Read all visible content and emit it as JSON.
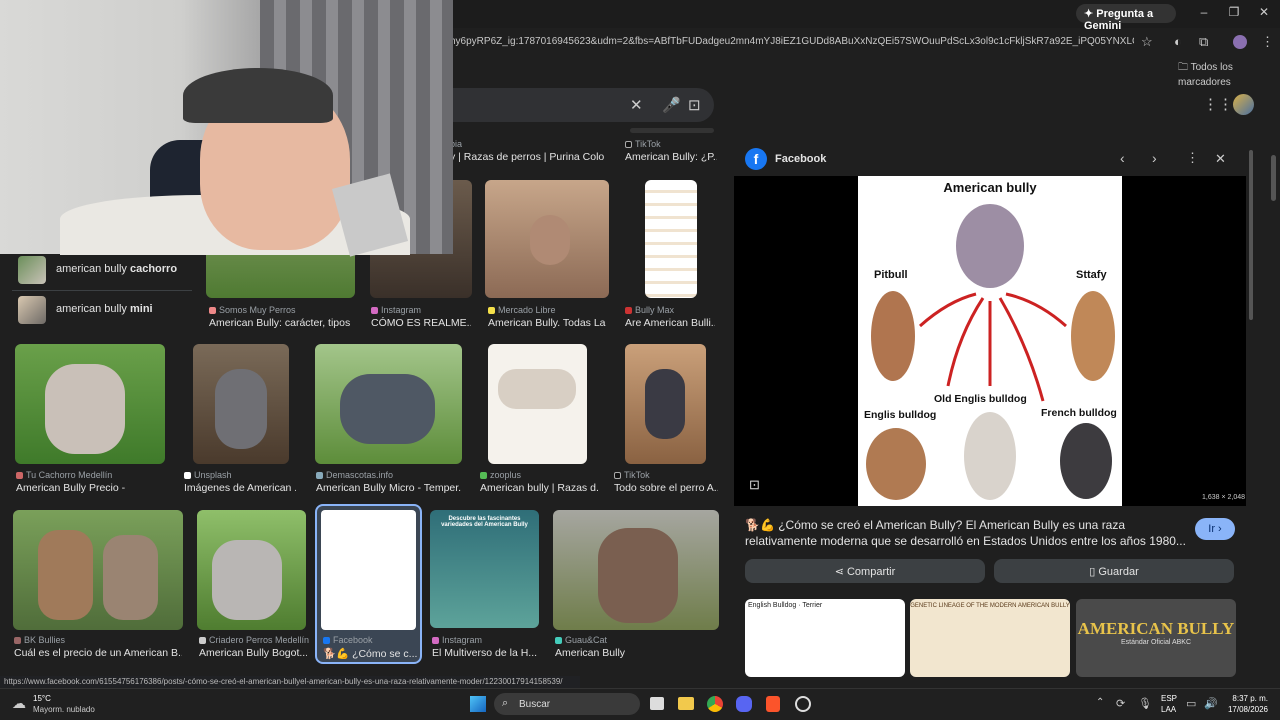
{
  "browser": {
    "gemini_label": "Pregunta a Gemini",
    "url": "hy6pyRP6Z_ig:1787016945623&udm=2&fbs=ABfTbFUDadgeu2mn4mYJ8iEZ1GUDd8ABuXxNzQEi57SWOuuPdScLx3ol9c1cFkljSkR7a92E_iPQ05YNXLGv14hv1DireQD...",
    "bookmarks_label": "Todos los marcadores"
  },
  "results_row0": [
    {
      "source": "bia",
      "caption": "y | Razas de perros | Purina Colo..."
    },
    {
      "source": "TikTok",
      "caption": "American Bully: ¿P..."
    }
  ],
  "suggestions": [
    {
      "prefix": "american bully ",
      "bold": "cachorro"
    },
    {
      "prefix": "american bully ",
      "bold": "mini"
    }
  ],
  "results_row1": [
    {
      "source": "Somos Muy Perros",
      "caption": "American Bully: carácter, tipos ..."
    },
    {
      "source": "Instagram",
      "caption": "CÓMO ES REALME..."
    },
    {
      "source": "Mercado Libre",
      "caption": "American Bully. Todas La..."
    },
    {
      "source": "Bully Max",
      "caption": "Are American Bulli..."
    }
  ],
  "results_row2": [
    {
      "source": "Tu Cachorro Medellín",
      "caption": "American Bully Precio -"
    },
    {
      "source": "Unsplash",
      "caption": "Imágenes de American ..."
    },
    {
      "source": "Demascotas.info",
      "caption": "American Bully Micro - Temper..."
    },
    {
      "source": "zooplus",
      "caption": "American bully | Razas d..."
    },
    {
      "source": "TikTok",
      "caption": "Todo sobre el perro A..."
    }
  ],
  "results_row3": [
    {
      "source": "BK Bullies",
      "caption": "Cuál es el precio de un American B..."
    },
    {
      "source": "Criadero Perros Medellín",
      "caption": "American Bully Bogot..."
    },
    {
      "source": "Facebook",
      "caption": "🐕💪 ¿Cómo se c..."
    },
    {
      "source": "Instagram",
      "caption": "El Multiverso de la H..."
    },
    {
      "source": "Guau&Cat",
      "caption": "American Bully"
    }
  ],
  "row3_thumb_text": {
    "t3": "Descubre las fascinantes variedades del American Bully"
  },
  "preview": {
    "source": "Facebook",
    "diagram_title": "American bully",
    "labels": {
      "pitbull": "Pitbull",
      "sttafy": "Sttafy",
      "old": "Old Englis bulldog",
      "englis": "Englis bulldog",
      "french": "French bulldog"
    },
    "dimensions": "1,638 × 2,048",
    "description": "🐕💪 ¿Cómo se creó el American Bully? El American Bully es una raza relativamente moderna que se desarrolló en Estados Unidos entre los años 1980...",
    "go_label": "Ir",
    "share_label": "Compartir",
    "save_label": "Guardar",
    "related": [
      {
        "text": "English Bulldog · Terrier"
      },
      {
        "text": "GENETIC LINEAGE OF THE MODERN AMERICAN BULLY"
      },
      {
        "title": "AMERICAN BULLY",
        "subtitle": "Estándar Oficial ABKC"
      }
    ]
  },
  "status_url": "https://www.facebook.com/61554756176386/posts/-cómo-se-creó-el-american-bullyel-american-bully-es-una-raza-relativamente-moder/12230017914158539/",
  "taskbar": {
    "temp": "15°C",
    "weather": "Mayorm. nublado",
    "search_label": "Buscar",
    "lang1": "ESP",
    "lang2": "LAA",
    "time": "8:37 p. m.",
    "date": "17/08/2026"
  }
}
